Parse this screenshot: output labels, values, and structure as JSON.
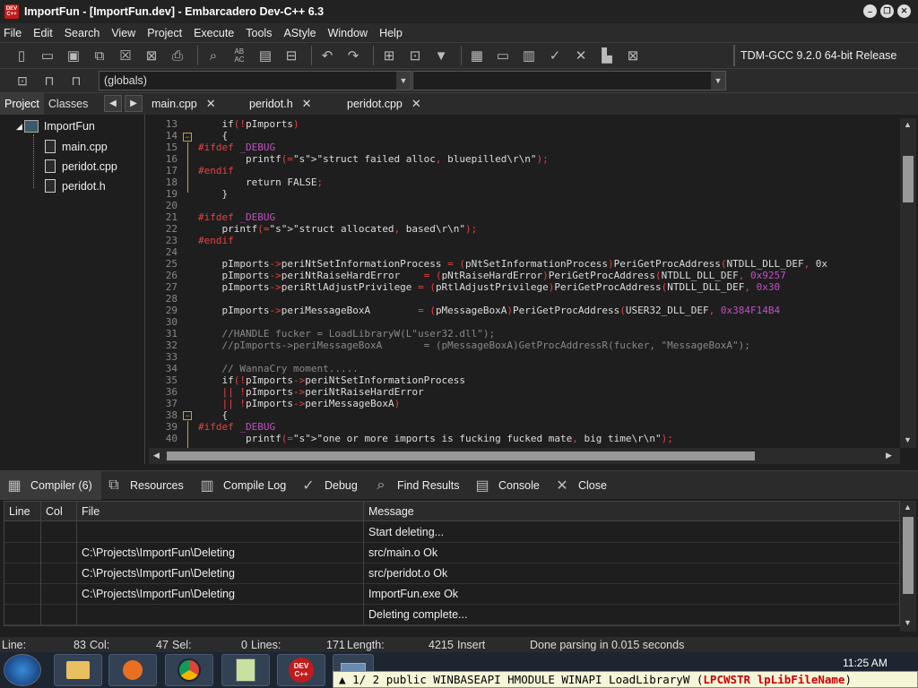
{
  "window": {
    "title": "ImportFun - [ImportFun.dev] - Embarcadero Dev-C++ 6.3"
  },
  "app_icon": {
    "label": "DEV C++"
  },
  "menu": [
    "File",
    "Edit",
    "Search",
    "View",
    "Project",
    "Execute",
    "Tools",
    "AStyle",
    "Window",
    "Help"
  ],
  "compiler": {
    "label": "TDM-GCC 9.2.0 64-bit Release"
  },
  "scope_combo": {
    "value": "(globals)"
  },
  "left_tabs": {
    "project": "Project",
    "classes": "Classes"
  },
  "tree": {
    "project": "ImportFun",
    "files": [
      "main.cpp",
      "peridot.cpp",
      "peridot.h"
    ]
  },
  "editor_tabs": [
    "main.cpp",
    "peridot.h",
    "peridot.cpp"
  ],
  "code": {
    "line_numbers": [
      "13",
      "14",
      "15",
      "16",
      "17",
      "18",
      "19",
      "20",
      "21",
      "22",
      "23",
      "24",
      "25",
      "26",
      "27",
      "28",
      "29",
      "30",
      "31",
      "32",
      "33",
      "34",
      "35",
      "36",
      "37",
      "38",
      "39",
      "40"
    ],
    "lines": [
      "    if(!pImports)",
      "    {",
      "#ifdef _DEBUG",
      "        printf(\"struct failed alloc, bluepilled\\r\\n\");",
      "#endif",
      "        return FALSE;",
      "    }",
      "",
      "#ifdef _DEBUG",
      "    printf(\"struct allocated, based\\r\\n\");",
      "#endif",
      "",
      "    pImports->periNtSetInformationProcess = (pNtSetInformationProcess)PeriGetProcAddress(NTDLL_DLL_DEF, 0x",
      "    pImports->periNtRaiseHardError    = (pNtRaiseHardError)PeriGetProcAddress(NTDLL_DLL_DEF, 0x9257",
      "    pImports->periRtlAdjustPrivilege = (pRtlAdjustPrivilege)PeriGetProcAddress(NTDLL_DLL_DEF, 0x30",
      "",
      "    pImports->periMessageBoxA        = (pMessageBoxA)PeriGetProcAddress(USER32_DLL_DEF, 0x384F14B4",
      "",
      "    //HANDLE fucker = LoadLibraryW(L\"user32.dll\");",
      "    //pImports->periMessageBoxA       = (pMessageBoxA)GetProcAddressR(fucker, \"MessageBoxA\");",
      "",
      "    // WannaCry moment.....",
      "    if(!pImports->periNtSetInformationProcess",
      "    || !pImports->periNtRaiseHardError",
      "    || !pImports->periMessageBoxA)",
      "    {",
      "#ifdef _DEBUG",
      "        printf(\"one or more imports is fucking fucked mate, big time\\r\\n\");"
    ]
  },
  "bottom_tabs": [
    "Compiler (6)",
    "Resources",
    "Compile Log",
    "Debug",
    "Find Results",
    "Console",
    "Close"
  ],
  "messages": {
    "headers": [
      "Line",
      "Col",
      "File",
      "Message"
    ],
    "rows": [
      {
        "line": "",
        "col": "",
        "file": "",
        "message": "Start deleting..."
      },
      {
        "line": "",
        "col": "",
        "file": "C:\\Projects\\ImportFun\\Deleting",
        "message": "src/main.o Ok"
      },
      {
        "line": "",
        "col": "",
        "file": "C:\\Projects\\ImportFun\\Deleting",
        "message": "src/peridot.o Ok"
      },
      {
        "line": "",
        "col": "",
        "file": "C:\\Projects\\ImportFun\\Deleting",
        "message": "ImportFun.exe Ok"
      },
      {
        "line": "",
        "col": "",
        "file": "",
        "message": "Deleting complete..."
      }
    ]
  },
  "status": {
    "line_label": "Line:",
    "line_val": "83",
    "col_label": "Col:",
    "col_val": "47",
    "sel_label": "Sel:",
    "sel_val": "0",
    "lines_label": "Lines:",
    "lines_val": "171",
    "length_label": "Length:",
    "length_val": "4215",
    "mode": "Insert",
    "parse": "Done parsing in 0.015 seconds"
  },
  "taskbar": {
    "clock": "11:25 AM"
  },
  "hint": {
    "counter": "1/ 2",
    "text": " public WINBASEAPI HMODULE WINAPI LoadLibraryW (",
    "param": "LPCWSTR lpLibFileName",
    "close": ")"
  }
}
